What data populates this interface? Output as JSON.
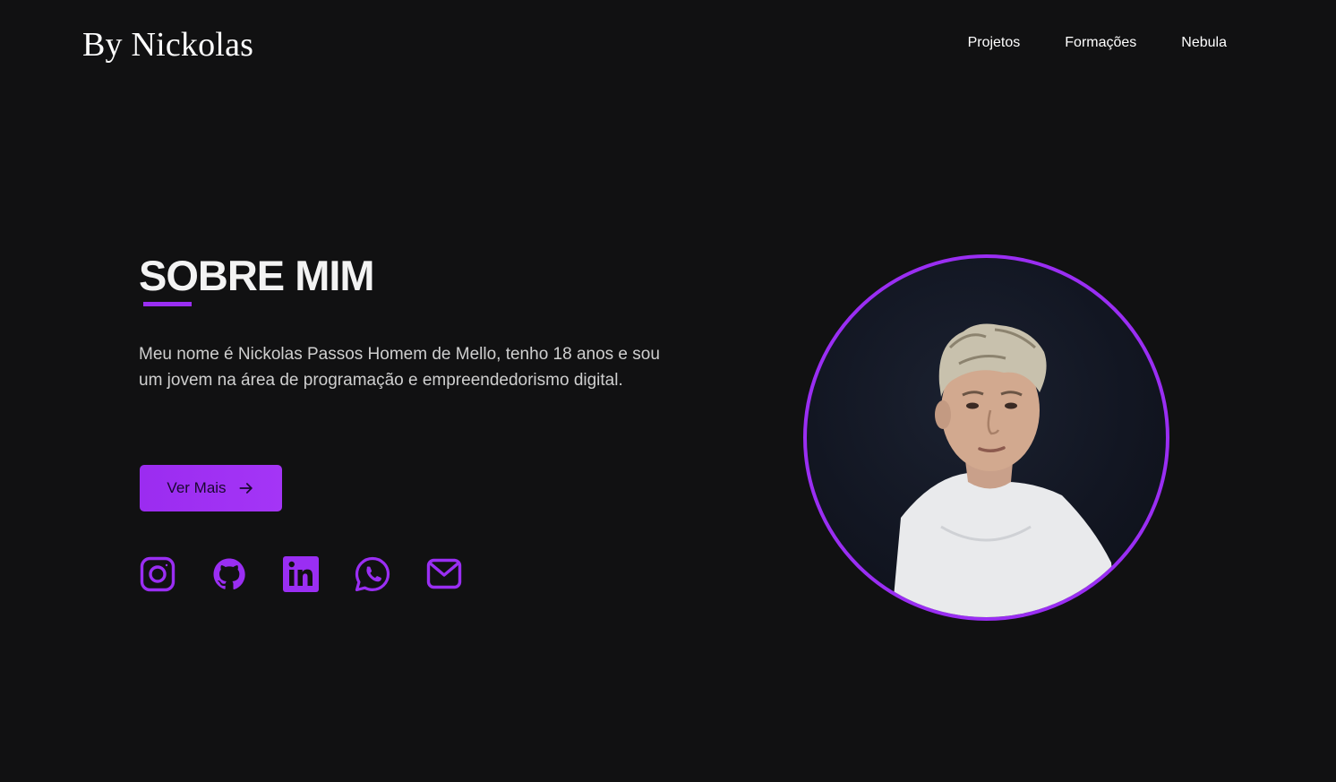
{
  "header": {
    "logo": "By Nickolas",
    "nav": [
      "Projetos",
      "Formações",
      "Nebula"
    ]
  },
  "about": {
    "title": "SOBRE MIM",
    "description": "Meu nome é Nickolas Passos Homem de Mello, tenho 18 anos e sou um jovem na área de programação e empreendedorismo digital.",
    "button_label": "Ver Mais"
  },
  "socials": [
    {
      "icon": "instagram-icon"
    },
    {
      "icon": "github-icon"
    },
    {
      "icon": "linkedin-icon"
    },
    {
      "icon": "whatsapp-icon"
    },
    {
      "icon": "mail-icon"
    }
  ],
  "colors": {
    "background": "#111112",
    "accent": "#9a2ef3",
    "text": "#ffffff",
    "muted_text": "#cfcfcf"
  }
}
